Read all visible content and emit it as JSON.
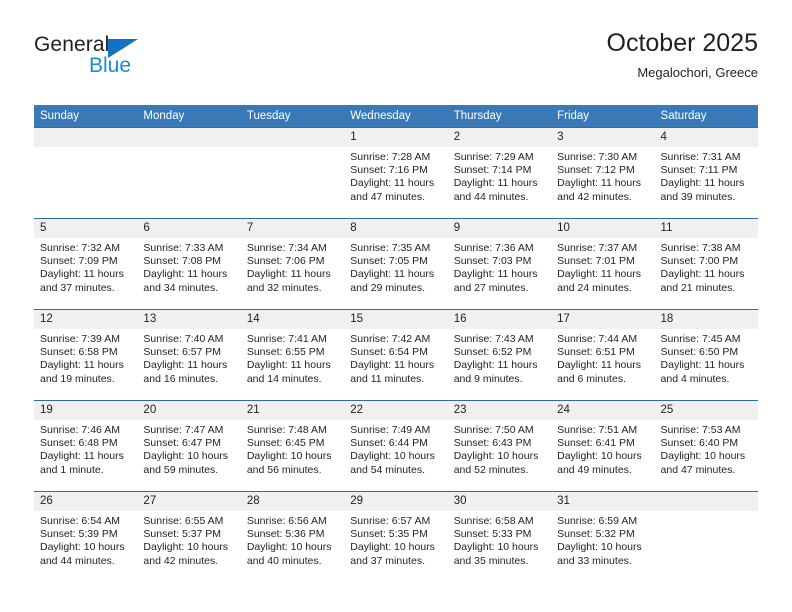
{
  "brand": {
    "name_top": "General",
    "name_bottom": "Blue",
    "triangle_color": "#1272c4",
    "blue_color": "#1c8ada"
  },
  "header": {
    "title": "October 2025",
    "subtitle": "Megalochori, Greece"
  },
  "colors": {
    "header_blue": "#3a79b8",
    "row_rule_blue": "#2d6ca8",
    "daynum_band": "#f0f0f0",
    "text": "#231f20"
  },
  "weekday_headers": [
    "Sunday",
    "Monday",
    "Tuesday",
    "Wednesday",
    "Thursday",
    "Friday",
    "Saturday"
  ],
  "labels": {
    "sunrise_prefix": "Sunrise:",
    "sunset_prefix": "Sunset:",
    "daylight_prefix": "Daylight:"
  },
  "weeks": [
    [
      {
        "day": "",
        "empty": true,
        "l1": "",
        "l2": "",
        "l3": "",
        "l4": ""
      },
      {
        "day": "",
        "empty": true,
        "l1": "",
        "l2": "",
        "l3": "",
        "l4": ""
      },
      {
        "day": "",
        "empty": true,
        "l1": "",
        "l2": "",
        "l3": "",
        "l4": ""
      },
      {
        "day": "1",
        "empty": false,
        "l1": "Sunrise: 7:28 AM",
        "l2": "Sunset: 7:16 PM",
        "l3": "Daylight: 11 hours",
        "l4": "and 47 minutes."
      },
      {
        "day": "2",
        "empty": false,
        "l1": "Sunrise: 7:29 AM",
        "l2": "Sunset: 7:14 PM",
        "l3": "Daylight: 11 hours",
        "l4": "and 44 minutes."
      },
      {
        "day": "3",
        "empty": false,
        "l1": "Sunrise: 7:30 AM",
        "l2": "Sunset: 7:12 PM",
        "l3": "Daylight: 11 hours",
        "l4": "and 42 minutes."
      },
      {
        "day": "4",
        "empty": false,
        "l1": "Sunrise: 7:31 AM",
        "l2": "Sunset: 7:11 PM",
        "l3": "Daylight: 11 hours",
        "l4": "and 39 minutes."
      }
    ],
    [
      {
        "day": "5",
        "empty": false,
        "l1": "Sunrise: 7:32 AM",
        "l2": "Sunset: 7:09 PM",
        "l3": "Daylight: 11 hours",
        "l4": "and 37 minutes."
      },
      {
        "day": "6",
        "empty": false,
        "l1": "Sunrise: 7:33 AM",
        "l2": "Sunset: 7:08 PM",
        "l3": "Daylight: 11 hours",
        "l4": "and 34 minutes."
      },
      {
        "day": "7",
        "empty": false,
        "l1": "Sunrise: 7:34 AM",
        "l2": "Sunset: 7:06 PM",
        "l3": "Daylight: 11 hours",
        "l4": "and 32 minutes."
      },
      {
        "day": "8",
        "empty": false,
        "l1": "Sunrise: 7:35 AM",
        "l2": "Sunset: 7:05 PM",
        "l3": "Daylight: 11 hours",
        "l4": "and 29 minutes."
      },
      {
        "day": "9",
        "empty": false,
        "l1": "Sunrise: 7:36 AM",
        "l2": "Sunset: 7:03 PM",
        "l3": "Daylight: 11 hours",
        "l4": "and 27 minutes."
      },
      {
        "day": "10",
        "empty": false,
        "l1": "Sunrise: 7:37 AM",
        "l2": "Sunset: 7:01 PM",
        "l3": "Daylight: 11 hours",
        "l4": "and 24 minutes."
      },
      {
        "day": "11",
        "empty": false,
        "l1": "Sunrise: 7:38 AM",
        "l2": "Sunset: 7:00 PM",
        "l3": "Daylight: 11 hours",
        "l4": "and 21 minutes."
      }
    ],
    [
      {
        "day": "12",
        "empty": false,
        "l1": "Sunrise: 7:39 AM",
        "l2": "Sunset: 6:58 PM",
        "l3": "Daylight: 11 hours",
        "l4": "and 19 minutes."
      },
      {
        "day": "13",
        "empty": false,
        "l1": "Sunrise: 7:40 AM",
        "l2": "Sunset: 6:57 PM",
        "l3": "Daylight: 11 hours",
        "l4": "and 16 minutes."
      },
      {
        "day": "14",
        "empty": false,
        "l1": "Sunrise: 7:41 AM",
        "l2": "Sunset: 6:55 PM",
        "l3": "Daylight: 11 hours",
        "l4": "and 14 minutes."
      },
      {
        "day": "15",
        "empty": false,
        "l1": "Sunrise: 7:42 AM",
        "l2": "Sunset: 6:54 PM",
        "l3": "Daylight: 11 hours",
        "l4": "and 11 minutes."
      },
      {
        "day": "16",
        "empty": false,
        "l1": "Sunrise: 7:43 AM",
        "l2": "Sunset: 6:52 PM",
        "l3": "Daylight: 11 hours",
        "l4": "and 9 minutes."
      },
      {
        "day": "17",
        "empty": false,
        "l1": "Sunrise: 7:44 AM",
        "l2": "Sunset: 6:51 PM",
        "l3": "Daylight: 11 hours",
        "l4": "and 6 minutes."
      },
      {
        "day": "18",
        "empty": false,
        "l1": "Sunrise: 7:45 AM",
        "l2": "Sunset: 6:50 PM",
        "l3": "Daylight: 11 hours",
        "l4": "and 4 minutes."
      }
    ],
    [
      {
        "day": "19",
        "empty": false,
        "l1": "Sunrise: 7:46 AM",
        "l2": "Sunset: 6:48 PM",
        "l3": "Daylight: 11 hours",
        "l4": "and 1 minute."
      },
      {
        "day": "20",
        "empty": false,
        "l1": "Sunrise: 7:47 AM",
        "l2": "Sunset: 6:47 PM",
        "l3": "Daylight: 10 hours",
        "l4": "and 59 minutes."
      },
      {
        "day": "21",
        "empty": false,
        "l1": "Sunrise: 7:48 AM",
        "l2": "Sunset: 6:45 PM",
        "l3": "Daylight: 10 hours",
        "l4": "and 56 minutes."
      },
      {
        "day": "22",
        "empty": false,
        "l1": "Sunrise: 7:49 AM",
        "l2": "Sunset: 6:44 PM",
        "l3": "Daylight: 10 hours",
        "l4": "and 54 minutes."
      },
      {
        "day": "23",
        "empty": false,
        "l1": "Sunrise: 7:50 AM",
        "l2": "Sunset: 6:43 PM",
        "l3": "Daylight: 10 hours",
        "l4": "and 52 minutes."
      },
      {
        "day": "24",
        "empty": false,
        "l1": "Sunrise: 7:51 AM",
        "l2": "Sunset: 6:41 PM",
        "l3": "Daylight: 10 hours",
        "l4": "and 49 minutes."
      },
      {
        "day": "25",
        "empty": false,
        "l1": "Sunrise: 7:53 AM",
        "l2": "Sunset: 6:40 PM",
        "l3": "Daylight: 10 hours",
        "l4": "and 47 minutes."
      }
    ],
    [
      {
        "day": "26",
        "empty": false,
        "l1": "Sunrise: 6:54 AM",
        "l2": "Sunset: 5:39 PM",
        "l3": "Daylight: 10 hours",
        "l4": "and 44 minutes."
      },
      {
        "day": "27",
        "empty": false,
        "l1": "Sunrise: 6:55 AM",
        "l2": "Sunset: 5:37 PM",
        "l3": "Daylight: 10 hours",
        "l4": "and 42 minutes."
      },
      {
        "day": "28",
        "empty": false,
        "l1": "Sunrise: 6:56 AM",
        "l2": "Sunset: 5:36 PM",
        "l3": "Daylight: 10 hours",
        "l4": "and 40 minutes."
      },
      {
        "day": "29",
        "empty": false,
        "l1": "Sunrise: 6:57 AM",
        "l2": "Sunset: 5:35 PM",
        "l3": "Daylight: 10 hours",
        "l4": "and 37 minutes."
      },
      {
        "day": "30",
        "empty": false,
        "l1": "Sunrise: 6:58 AM",
        "l2": "Sunset: 5:33 PM",
        "l3": "Daylight: 10 hours",
        "l4": "and 35 minutes."
      },
      {
        "day": "31",
        "empty": false,
        "l1": "Sunrise: 6:59 AM",
        "l2": "Sunset: 5:32 PM",
        "l3": "Daylight: 10 hours",
        "l4": "and 33 minutes."
      },
      {
        "day": "",
        "empty": true,
        "l1": "",
        "l2": "",
        "l3": "",
        "l4": ""
      }
    ]
  ]
}
